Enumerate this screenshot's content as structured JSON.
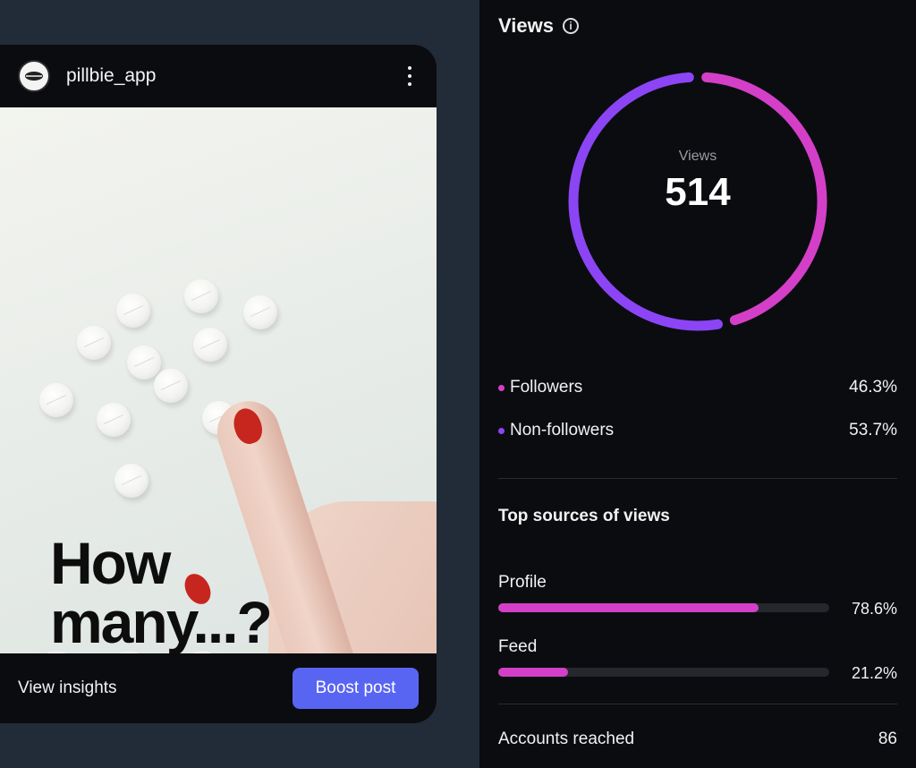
{
  "post": {
    "username": "pillbie_app",
    "overlay_line1": "How",
    "overlay_line2": "many...?",
    "view_insights_label": "View insights",
    "boost_label": "Boost post"
  },
  "panel": {
    "title": "Views",
    "donut_label": "Views",
    "total_views": "514",
    "legend": [
      {
        "label": "Followers",
        "pct": "46.3%",
        "color": "#d43fc8",
        "fraction": 0.463
      },
      {
        "label": "Non-followers",
        "pct": "53.7%",
        "color": "#8b45f5",
        "fraction": 0.537
      }
    ],
    "sources_title": "Top sources of views",
    "sources": [
      {
        "label": "Profile",
        "pct": "78.6%",
        "fraction": 0.786
      },
      {
        "label": "Feed",
        "pct": "21.2%",
        "fraction": 0.212
      }
    ],
    "reached_label": "Accounts reached",
    "reached_value": "86"
  },
  "colors": {
    "accent_pink": "#d43fc8",
    "accent_purple": "#8b45f5",
    "boost_button": "#5865f2"
  }
}
